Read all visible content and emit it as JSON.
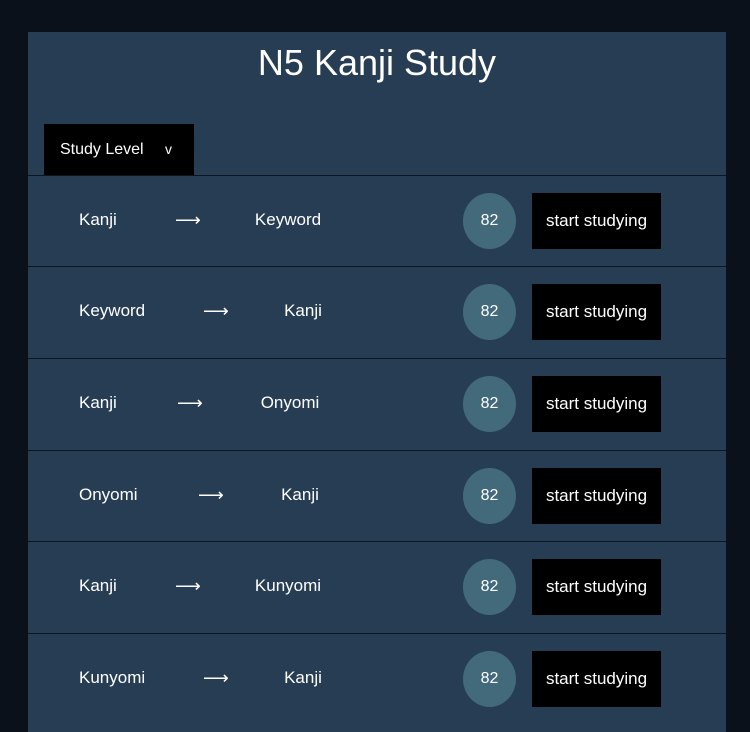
{
  "header": {
    "title": "N5 Kanji Study"
  },
  "level_select": {
    "label": "Study Level",
    "chevron": "v"
  },
  "arrow_glyph": "⟶",
  "rows": [
    {
      "from": "Kanji",
      "to": "Keyword",
      "count": "82",
      "button": "start studying"
    },
    {
      "from": "Keyword",
      "to": "Kanji",
      "count": "82",
      "button": "start studying"
    },
    {
      "from": "Kanji",
      "to": "Onyomi",
      "count": "82",
      "button": "start studying"
    },
    {
      "from": "Onyomi",
      "to": "Kanji",
      "count": "82",
      "button": "start studying"
    },
    {
      "from": "Kanji",
      "to": "Kunyomi",
      "count": "82",
      "button": "start studying"
    },
    {
      "from": "Kunyomi",
      "to": "Kanji",
      "count": "82",
      "button": "start studying"
    }
  ],
  "colors": {
    "page_background": "#0b111a",
    "panel_background": "#273d54",
    "count_badge": "#426a7a",
    "button_background": "#000000"
  }
}
